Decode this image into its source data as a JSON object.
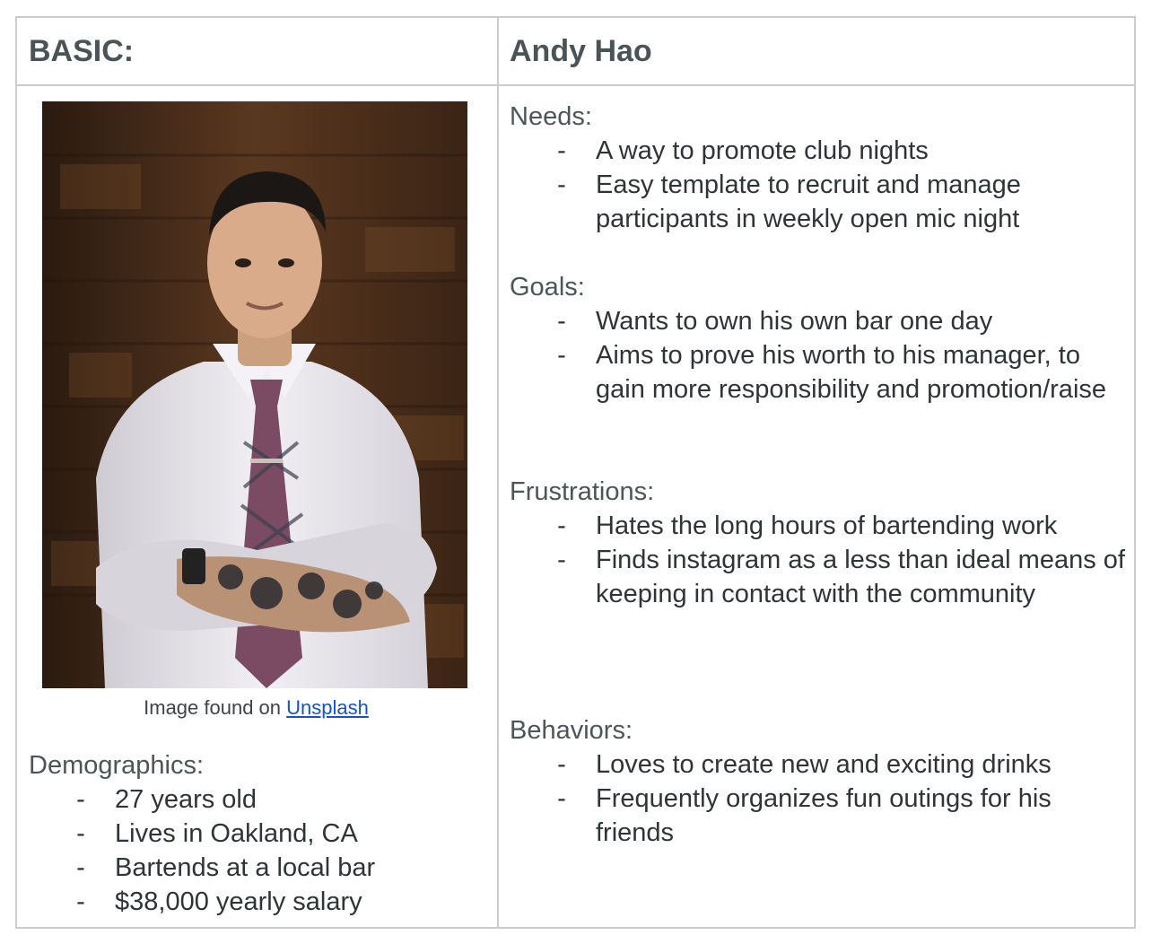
{
  "header": {
    "left_label": "BASIC:",
    "right_label": "Andy Hao"
  },
  "photo": {
    "subject": "portrait of a man with arms crossed in front of a wooden wall",
    "caption_prefix": "Image found on ",
    "caption_link": "Unsplash",
    "colors": {
      "shirt": "#e9e6ec",
      "tie": "#7a4b62",
      "wall": "#4a2e1c",
      "hair": "#1b1714",
      "skin": "#d9ab8a"
    }
  },
  "demographics": {
    "title": "Demographics:",
    "items": [
      "27 years old",
      "Lives in Oakland, CA",
      "Bartends at a local bar",
      "$38,000 yearly salary"
    ]
  },
  "needs": {
    "title": "Needs:",
    "items": [
      "A way to promote club nights",
      "Easy template to recruit and manage participants in weekly open mic night"
    ]
  },
  "goals": {
    "title": "Goals:",
    "items": [
      "Wants to own his own bar one day",
      "Aims to prove his worth to his manager, to gain more responsibility and promotion/raise"
    ]
  },
  "frustrations": {
    "title": "Frustrations:",
    "items": [
      "Hates the long hours of bartending work",
      "Finds instagram as a less than ideal means of keeping in contact with the community"
    ]
  },
  "behaviors": {
    "title": "Behaviors:",
    "items": [
      "Loves to create new and exciting drinks",
      "Frequently organizes fun outings for his friends"
    ]
  },
  "bullet_marker": "-"
}
